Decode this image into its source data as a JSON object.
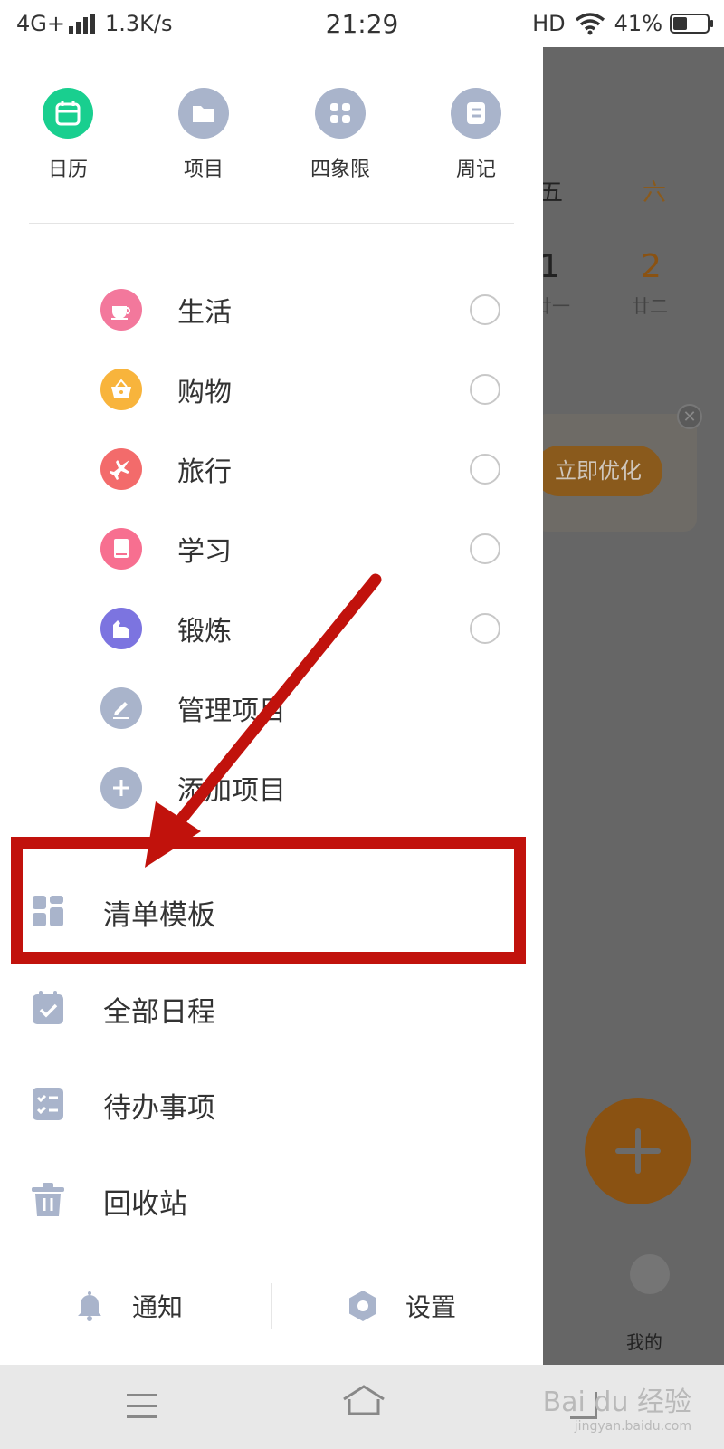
{
  "status_bar": {
    "network": "4G+",
    "speed": "1.3K/s",
    "time": "21:29",
    "hd": "HD",
    "battery": "41%",
    "battery_level": 0.41
  },
  "quick_nav": [
    {
      "label": "日历",
      "icon": "calendar-icon",
      "color": "#19cf8f"
    },
    {
      "label": "项目",
      "icon": "folder-icon",
      "color": "#a9b4cb"
    },
    {
      "label": "四象限",
      "icon": "grid-icon",
      "color": "#a9b4cb"
    },
    {
      "label": "周记",
      "icon": "note-icon",
      "color": "#a9b4cb"
    }
  ],
  "projects": [
    {
      "label": "生活",
      "icon": "cup-icon",
      "color": "#f3789c"
    },
    {
      "label": "购物",
      "icon": "basket-icon",
      "color": "#f8b43c"
    },
    {
      "label": "旅行",
      "icon": "airplane-icon",
      "color": "#f36b6b"
    },
    {
      "label": "学习",
      "icon": "book-icon",
      "color": "#f76f90"
    },
    {
      "label": "锻炼",
      "icon": "arm-icon",
      "color": "#7c74e0"
    }
  ],
  "project_actions": [
    {
      "label": "管理项目",
      "icon": "edit-icon",
      "color": "#a9b4cb"
    },
    {
      "label": "添加项目",
      "icon": "plus-icon",
      "color": "#a9b4cb"
    }
  ],
  "menu": [
    {
      "label": "清单模板",
      "icon": "template-icon"
    },
    {
      "label": "全部日程",
      "icon": "calendar-check-icon"
    },
    {
      "label": "待办事项",
      "icon": "checklist-icon"
    },
    {
      "label": "回收站",
      "icon": "trash-icon"
    }
  ],
  "bottom": {
    "notify": "通知",
    "settings": "设置"
  },
  "background": {
    "weekday_fri": "五",
    "weekday_sat": "六",
    "day_1": "1",
    "day_2": "2",
    "lunar_1": "廿一",
    "lunar_2": "廿二",
    "optimize": "立即优化",
    "me": "我的"
  },
  "watermark": {
    "brand": "Bai du 经验",
    "url": "jingyan.baidu.com"
  },
  "colors": {
    "accent_orange": "#f08c00",
    "highlight_red": "#c1120c",
    "icon_gray": "#a9b4cb"
  }
}
